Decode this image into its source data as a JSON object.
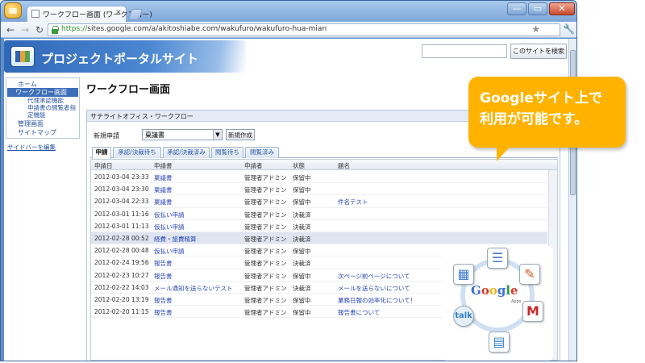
{
  "browser": {
    "tab_title": "ワークフロー画面 (ワークフロー)",
    "tab_close": "×",
    "url_scheme": "https://",
    "url_rest": "sites.google.com/a/akitoshiabe.com/wakufuro/wakufuro-hua-mian",
    "window_controls": {
      "minimize": "—",
      "maximize": "▭",
      "close": "✕"
    },
    "icons": [
      "app-logo-icon",
      "back-icon",
      "forward-icon",
      "reload-icon",
      "lock-icon",
      "star-icon",
      "wrench-icon"
    ]
  },
  "site": {
    "title": "プロジェクトポータルサイト",
    "search_button": "このサイトを検索",
    "search_value": ""
  },
  "sidebar": {
    "items": [
      {
        "label": "ホーム"
      },
      {
        "label": "ワークフロー画面",
        "active": true
      },
      {
        "label": "代理承認機能"
      },
      {
        "label": "申請書の閲覧者指"
      },
      {
        "label": "定機能"
      },
      {
        "label": "管理画面"
      },
      {
        "label": "サイトマップ"
      }
    ],
    "edit_link": "サイドバーを編集"
  },
  "page": {
    "title": "ワークフロー画面"
  },
  "gadget": {
    "title": "サテライトオフィス・ワークフロー",
    "new_request_label": "新規申請",
    "form_select_value": "稟議書",
    "create_button": "新規作成",
    "tabs": [
      "申請",
      "承認/決裁待ち",
      "承認/決裁済み",
      "閲覧待ち",
      "閲覧済み"
    ],
    "active_tab": 0,
    "columns": [
      "申請日",
      "申請書",
      "申請者",
      "状態",
      "題名"
    ],
    "rows": [
      {
        "date": "2012-03-04 23:33",
        "form": "稟議書",
        "applicant": "管理者アドミン",
        "status": "保留中",
        "subject": ""
      },
      {
        "date": "2012-03-04 23:30",
        "form": "稟議書",
        "applicant": "管理者アドミン",
        "status": "保留中",
        "subject": ""
      },
      {
        "date": "2012-03-04 22:33",
        "form": "稟議書",
        "applicant": "管理者アドミン",
        "status": "保留中",
        "subject": "件名テスト"
      },
      {
        "date": "2012-03-01 11:16",
        "form": "仮払い申請",
        "applicant": "管理者アドミン",
        "status": "決裁済",
        "subject": ""
      },
      {
        "date": "2012-03-01 11:13",
        "form": "仮払い申請",
        "applicant": "管理者アドミン",
        "status": "決裁済",
        "subject": ""
      },
      {
        "date": "2012-02-28 00:52",
        "form": "経費・旅費精算",
        "applicant": "管理者アドミン",
        "status": "決裁済",
        "subject": "",
        "highlight": true
      },
      {
        "date": "2012-02-28 00:48",
        "form": "仮払い申請",
        "applicant": "管理者アドミン",
        "status": "保留中",
        "subject": ""
      },
      {
        "date": "2012-02-24 19:56",
        "form": "報告書",
        "applicant": "管理者アドミン",
        "status": "決裁済",
        "subject": ""
      },
      {
        "date": "2012-02-23 10:27",
        "form": "報告書",
        "applicant": "管理者アドミン",
        "status": "保留中",
        "subject": "次ページ前ページについて"
      },
      {
        "date": "2012-02-22 14:03",
        "form": "メール通知を送らないテスト",
        "applicant": "管理者アドミン",
        "status": "決裁済",
        "subject": "メールを送らないについて"
      },
      {
        "date": "2012-02-20 13:19",
        "form": "報告書",
        "applicant": "管理者アドミン",
        "status": "保留中",
        "subject": "業務日報の効率化について！"
      },
      {
        "date": "2012-02-20 11:15",
        "form": "報告書",
        "applicant": "管理者アドミン",
        "status": "保留中",
        "subject": "報告書について"
      }
    ]
  },
  "callout": {
    "line1": "Googleサイト上で",
    "line2": "利用が可能です。",
    "color": "#ffb300"
  },
  "apps_graphic": {
    "logo": "Google",
    "sub_label": "Apps",
    "icons": [
      "calendar-icon",
      "docs-icon",
      "drawing-icon",
      "gmail-icon",
      "sites-icon",
      "talk-icon"
    ],
    "talk_text": "talk"
  },
  "colors": {
    "banner": "#2f67b8",
    "link": "#2a46b6",
    "active_nav": "#3d6fb9"
  }
}
